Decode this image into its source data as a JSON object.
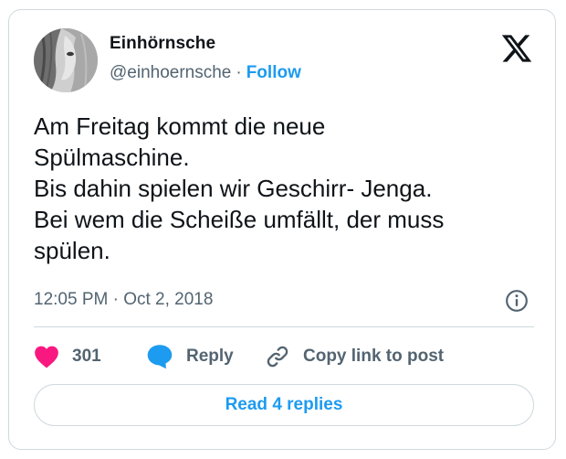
{
  "author": {
    "name": "Einhörnsche",
    "handle": "@einhoernsche",
    "separator": "·",
    "follow_label": "Follow"
  },
  "tweet": {
    "lines": [
      "Am Freitag kommt die neue",
      "Spülmaschine.",
      "Bis dahin spielen wir Geschirr- Jenga.",
      "Bei wem die Scheiße umfällt, der muss",
      "spülen."
    ],
    "timestamp": "12:05 PM · Oct 2, 2018"
  },
  "actions": {
    "like_count": "301",
    "reply_label": "Reply",
    "copy_label": "Copy link to post"
  },
  "read_replies_label": "Read 4 replies",
  "icons": {
    "brand": "x-logo-icon",
    "info": "info-icon",
    "like": "heart-icon",
    "reply": "speech-bubble-icon",
    "copy": "link-icon"
  },
  "colors": {
    "accent": "#1d9bf0",
    "heart": "#f91880",
    "muted": "#536471",
    "border": "#cfd9de"
  }
}
